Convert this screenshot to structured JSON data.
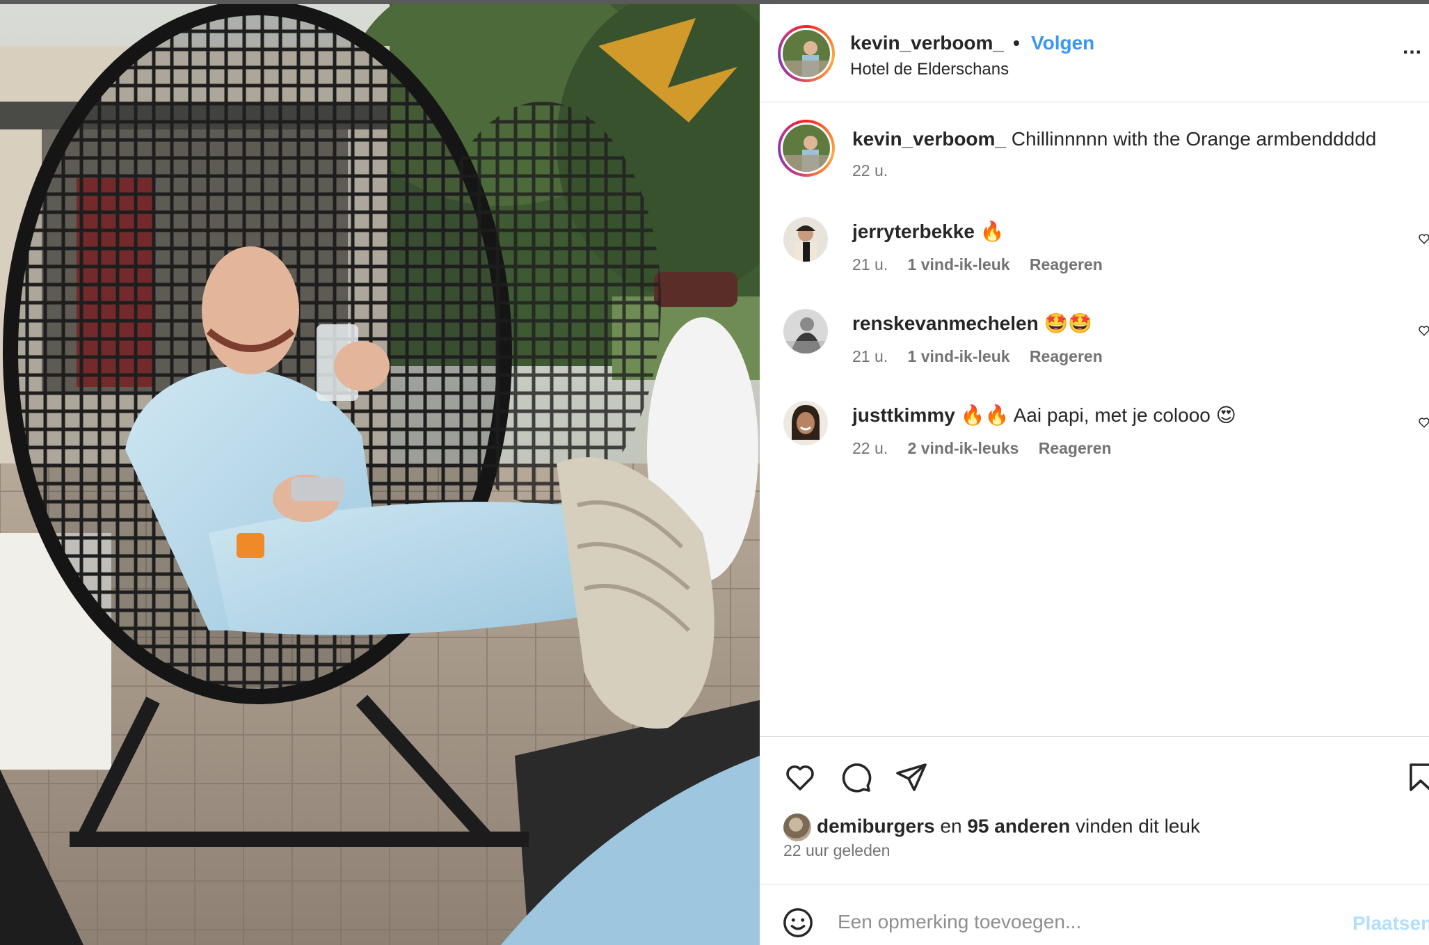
{
  "post": {
    "username": "kevin_verboom_",
    "follow_label": "Volgen",
    "separator": "•",
    "location": "Hotel de Elderschans",
    "more_label": "..."
  },
  "caption": {
    "username": "kevin_verboom_",
    "text": "Chillinnnnn with the Orange armbenddddd",
    "time": "22 u."
  },
  "comments": [
    {
      "username": "jerryterbekke",
      "text": "🔥",
      "time": "21 u.",
      "likes": "1 vind-ik-leuk",
      "reply": "Reageren"
    },
    {
      "username": "renskevanmechelen",
      "text": "🤩🤩",
      "time": "21 u.",
      "likes": "1 vind-ik-leuk",
      "reply": "Reageren"
    },
    {
      "username": "justtkimmy",
      "text": "🔥🔥 Aai papi, met je colooo 😍",
      "time": "22 u.",
      "likes": "2 vind-ik-leuks",
      "reply": "Reageren"
    }
  ],
  "likes": {
    "user": "demiburgers",
    "connector": "en",
    "others": "95 anderen",
    "suffix": "vinden dit leuk",
    "time": "22 uur geleden"
  },
  "add_comment": {
    "placeholder": "Een opmerking toevoegen...",
    "post_label": "Plaatsen"
  },
  "icons": [
    "heart-icon",
    "comment-icon",
    "share-icon",
    "bookmark-icon",
    "emoji-icon",
    "more-options-icon"
  ],
  "colors": {
    "follow": "#3897f0",
    "post_disabled": "#b2dffc",
    "muted": "#737373",
    "divider": "#dbdbdb"
  }
}
